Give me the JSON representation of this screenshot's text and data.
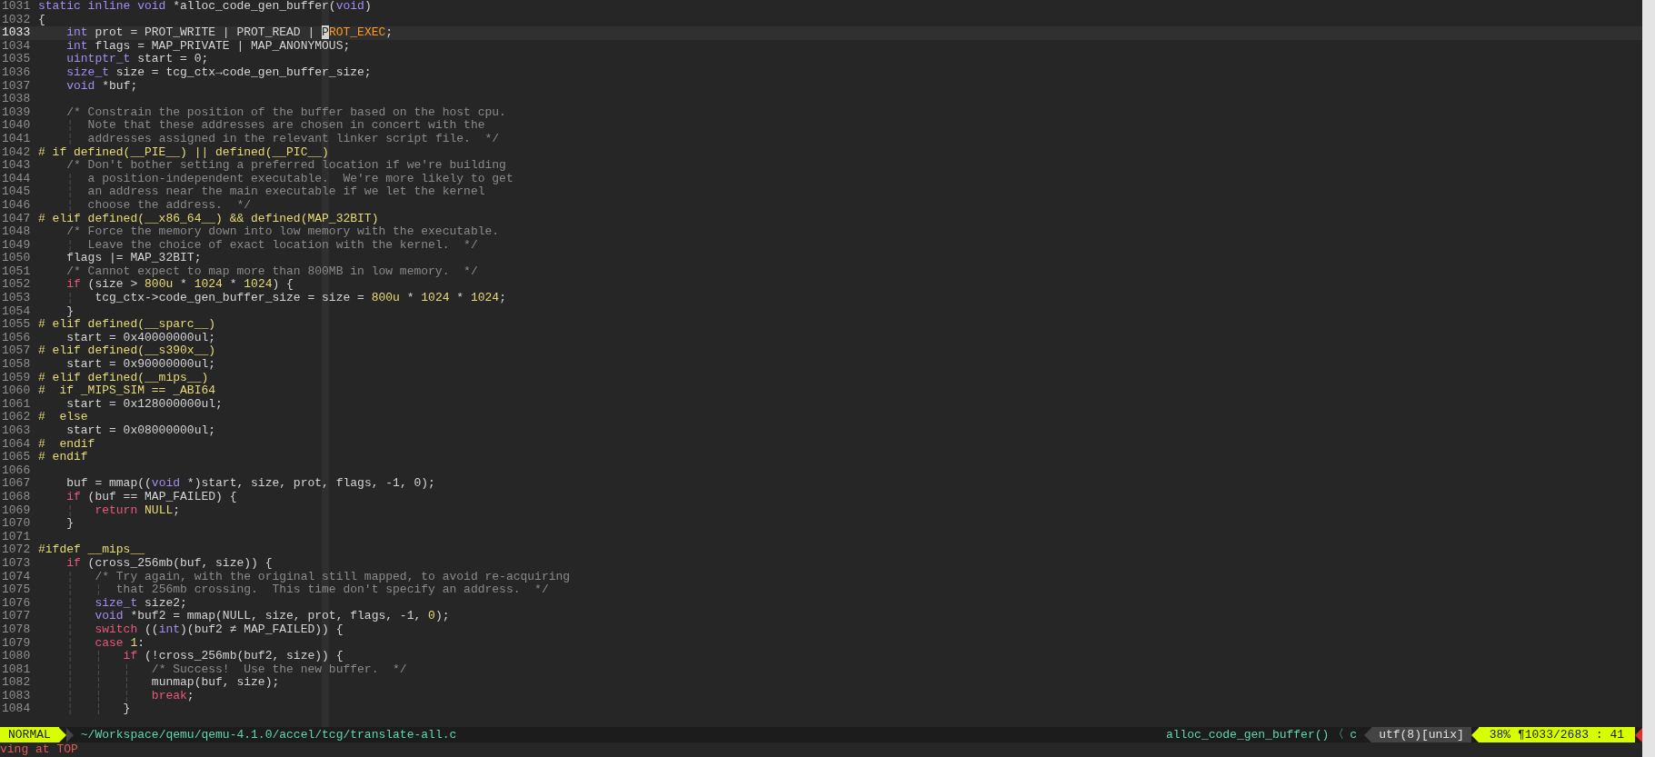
{
  "editor": {
    "lines": [
      {
        "number": "1031",
        "current": false,
        "segments": [
          {
            "kind": "type",
            "text": "static inline void"
          },
          {
            "kind": "plain",
            "text": " *alloc_code_gen_buffer("
          },
          {
            "kind": "type",
            "text": "void"
          },
          {
            "kind": "plain",
            "text": ")"
          }
        ]
      },
      {
        "number": "1032",
        "current": false,
        "segments": [
          {
            "kind": "plain",
            "text": "{"
          }
        ]
      },
      {
        "number": "1033",
        "current": true,
        "segments": [
          {
            "kind": "type",
            "text": "    int"
          },
          {
            "kind": "plain",
            "text": " prot = PROT_WRITE | PROT_READ | "
          },
          {
            "kind": "cursor",
            "text": "P"
          },
          {
            "kind": "match",
            "text": "ROT_EXEC"
          },
          {
            "kind": "plain",
            "text": ";"
          }
        ]
      },
      {
        "number": "1034",
        "current": false,
        "segments": [
          {
            "kind": "type",
            "text": "    int"
          },
          {
            "kind": "plain",
            "text": " flags = MAP_PRIVATE | MAP_ANONYMOUS;"
          }
        ]
      },
      {
        "number": "1035",
        "current": false,
        "segments": [
          {
            "kind": "type",
            "text": "    uintptr_t"
          },
          {
            "kind": "plain",
            "text": " start = 0;"
          }
        ]
      },
      {
        "number": "1036",
        "current": false,
        "segments": [
          {
            "kind": "type",
            "text": "    size_t"
          },
          {
            "kind": "plain",
            "text": " size = tcg_ctx→code_gen_buffer_size;"
          }
        ]
      },
      {
        "number": "1037",
        "current": false,
        "segments": [
          {
            "kind": "type",
            "text": "    void"
          },
          {
            "kind": "plain",
            "text": " *buf;"
          }
        ]
      },
      {
        "number": "1038",
        "current": false
      },
      {
        "number": "1039",
        "current": false,
        "segments": [
          {
            "kind": "comment",
            "text": "    /* Constrain the position of the buffer based on the host cpu."
          }
        ]
      },
      {
        "number": "1040",
        "current": false,
        "segments": [
          {
            "kind": "guide",
            "text": "    ¦"
          },
          {
            "kind": "comment",
            "text": "  Note that these addresses are chosen in concert with the"
          }
        ]
      },
      {
        "number": "1041",
        "current": false,
        "segments": [
          {
            "kind": "guide",
            "text": "    ¦"
          },
          {
            "kind": "comment",
            "text": "  addresses assigned in the relevant linker script file.  */"
          }
        ]
      },
      {
        "number": "1042",
        "current": false,
        "segments": [
          {
            "kind": "preproc",
            "text": "# if defined(__PIE__) || defined(__PIC__)"
          }
        ]
      },
      {
        "number": "1043",
        "current": false,
        "segments": [
          {
            "kind": "comment",
            "text": "    /* Don't bother setting a preferred location if we're building"
          }
        ]
      },
      {
        "number": "1044",
        "current": false,
        "segments": [
          {
            "kind": "guide",
            "text": "    ¦"
          },
          {
            "kind": "comment",
            "text": "  a position-independent executable.  We're more likely to get"
          }
        ]
      },
      {
        "number": "1045",
        "current": false,
        "segments": [
          {
            "kind": "guide",
            "text": "    ¦"
          },
          {
            "kind": "comment",
            "text": "  an address near the main executable if we let the kernel"
          }
        ]
      },
      {
        "number": "1046",
        "current": false,
        "segments": [
          {
            "kind": "guide",
            "text": "    ¦"
          },
          {
            "kind": "comment",
            "text": "  choose the address.  */"
          }
        ]
      },
      {
        "number": "1047",
        "current": false,
        "segments": [
          {
            "kind": "preproc",
            "text": "# elif defined(__x86_64__) && defined(MAP_32BIT)"
          }
        ]
      },
      {
        "number": "1048",
        "current": false,
        "segments": [
          {
            "kind": "comment",
            "text": "    /* Force the memory down into low memory with the executable."
          }
        ]
      },
      {
        "number": "1049",
        "current": false,
        "segments": [
          {
            "kind": "guide",
            "text": "    ¦"
          },
          {
            "kind": "comment",
            "text": "  Leave the choice of exact location with the kernel.  */"
          }
        ]
      },
      {
        "number": "1050",
        "current": false,
        "segments": [
          {
            "kind": "plain",
            "text": "    flags |= MAP_32BIT;"
          }
        ]
      },
      {
        "number": "1051",
        "current": false,
        "segments": [
          {
            "kind": "comment",
            "text": "    /* Cannot expect to map more than 800MB in low memory.  */"
          }
        ]
      },
      {
        "number": "1052",
        "current": false,
        "segments": [
          {
            "kind": "keyword",
            "text": "    if"
          },
          {
            "kind": "plain",
            "text": " (size > "
          },
          {
            "kind": "number",
            "text": "800u"
          },
          {
            "kind": "plain",
            "text": " * "
          },
          {
            "kind": "number",
            "text": "1024"
          },
          {
            "kind": "plain",
            "text": " * "
          },
          {
            "kind": "number",
            "text": "1024"
          },
          {
            "kind": "plain",
            "text": ") {"
          }
        ]
      },
      {
        "number": "1053",
        "current": false,
        "segments": [
          {
            "kind": "guide",
            "text": "    ¦"
          },
          {
            "kind": "plain",
            "text": "   tcg_ctx->code_gen_buffer_size = size = "
          },
          {
            "kind": "number",
            "text": "800u"
          },
          {
            "kind": "plain",
            "text": " * "
          },
          {
            "kind": "number",
            "text": "1024"
          },
          {
            "kind": "plain",
            "text": " * "
          },
          {
            "kind": "number",
            "text": "1024"
          },
          {
            "kind": "plain",
            "text": ";"
          }
        ]
      },
      {
        "number": "1054",
        "current": false,
        "segments": [
          {
            "kind": "plain",
            "text": "    }"
          }
        ]
      },
      {
        "number": "1055",
        "current": false,
        "segments": [
          {
            "kind": "preproc",
            "text": "# elif defined(__sparc__)"
          }
        ]
      },
      {
        "number": "1056",
        "current": false,
        "segments": [
          {
            "kind": "plain",
            "text": "    start = 0x40000000ul;"
          }
        ]
      },
      {
        "number": "1057",
        "current": false,
        "segments": [
          {
            "kind": "preproc",
            "text": "# elif defined(__s390x__)"
          }
        ]
      },
      {
        "number": "1058",
        "current": false,
        "segments": [
          {
            "kind": "plain",
            "text": "    start = 0x90000000ul;"
          }
        ]
      },
      {
        "number": "1059",
        "current": false,
        "segments": [
          {
            "kind": "preproc",
            "text": "# elif defined(__mips__)"
          }
        ]
      },
      {
        "number": "1060",
        "current": false,
        "segments": [
          {
            "kind": "preproc",
            "text": "#  if _MIPS_SIM == _ABI64"
          }
        ]
      },
      {
        "number": "1061",
        "current": false,
        "segments": [
          {
            "kind": "plain",
            "text": "    start = 0x128000000ul;"
          }
        ]
      },
      {
        "number": "1062",
        "current": false,
        "segments": [
          {
            "kind": "preproc",
            "text": "#  else"
          }
        ]
      },
      {
        "number": "1063",
        "current": false,
        "segments": [
          {
            "kind": "plain",
            "text": "    start = 0x08000000ul;"
          }
        ]
      },
      {
        "number": "1064",
        "current": false,
        "segments": [
          {
            "kind": "preproc",
            "text": "#  endif"
          }
        ]
      },
      {
        "number": "1065",
        "current": false,
        "segments": [
          {
            "kind": "preproc",
            "text": "# endif"
          }
        ]
      },
      {
        "number": "1066",
        "current": false
      },
      {
        "number": "1067",
        "current": false,
        "segments": [
          {
            "kind": "plain",
            "text": "    buf = mmap(("
          },
          {
            "kind": "type",
            "text": "void"
          },
          {
            "kind": "plain",
            "text": " *)start, size, prot, flags, -1, 0);"
          }
        ]
      },
      {
        "number": "1068",
        "current": false,
        "segments": [
          {
            "kind": "keyword",
            "text": "    if"
          },
          {
            "kind": "plain",
            "text": " (buf == MAP_FAILED) {"
          }
        ]
      },
      {
        "number": "1069",
        "current": false,
        "segments": [
          {
            "kind": "guide",
            "text": "    ¦"
          },
          {
            "kind": "keyword",
            "text": "   return"
          },
          {
            "kind": "number",
            "text": " NULL"
          },
          {
            "kind": "plain",
            "text": ";"
          }
        ]
      },
      {
        "number": "1070",
        "current": false,
        "segments": [
          {
            "kind": "plain",
            "text": "    }"
          }
        ]
      },
      {
        "number": "1071",
        "current": false
      },
      {
        "number": "1072",
        "current": false,
        "segments": [
          {
            "kind": "preproc",
            "text": "#ifdef __mips__"
          }
        ]
      },
      {
        "number": "1073",
        "current": false,
        "segments": [
          {
            "kind": "keyword",
            "text": "    if"
          },
          {
            "kind": "plain",
            "text": " (cross_256mb(buf, size)) {"
          }
        ]
      },
      {
        "number": "1074",
        "current": false,
        "segments": [
          {
            "kind": "guide",
            "text": "    ¦"
          },
          {
            "kind": "comment",
            "text": "   /* Try again, with the original still mapped, to avoid re-acquiring"
          }
        ]
      },
      {
        "number": "1075",
        "current": false,
        "segments": [
          {
            "kind": "guide",
            "text": "    ¦   ¦"
          },
          {
            "kind": "comment",
            "text": "  that 256mb crossing.  This time don't specify an address.  */"
          }
        ]
      },
      {
        "number": "1076",
        "current": false,
        "segments": [
          {
            "kind": "guide",
            "text": "    ¦"
          },
          {
            "kind": "type",
            "text": "   size_t"
          },
          {
            "kind": "plain",
            "text": " size2;"
          }
        ]
      },
      {
        "number": "1077",
        "current": false,
        "segments": [
          {
            "kind": "guide",
            "text": "    ¦"
          },
          {
            "kind": "type",
            "text": "   void"
          },
          {
            "kind": "plain",
            "text": " *buf2 = mmap(NULL, size, prot, flags, -1, "
          },
          {
            "kind": "number",
            "text": "0"
          },
          {
            "kind": "plain",
            "text": ");"
          }
        ]
      },
      {
        "number": "1078",
        "current": false,
        "segments": [
          {
            "kind": "guide",
            "text": "    ¦"
          },
          {
            "kind": "keyword",
            "text": "   switch"
          },
          {
            "kind": "plain",
            "text": " (("
          },
          {
            "kind": "type",
            "text": "int"
          },
          {
            "kind": "plain",
            "text": ")(buf2 ≠ MAP_FAILED)) {"
          }
        ]
      },
      {
        "number": "1079",
        "current": false,
        "segments": [
          {
            "kind": "guide",
            "text": "    ¦"
          },
          {
            "kind": "keyword",
            "text": "   case"
          },
          {
            "kind": "number",
            "text": " 1"
          },
          {
            "kind": "plain",
            "text": ":"
          }
        ]
      },
      {
        "number": "1080",
        "current": false,
        "segments": [
          {
            "kind": "guide",
            "text": "    ¦   ¦"
          },
          {
            "kind": "keyword",
            "text": "   if"
          },
          {
            "kind": "plain",
            "text": " (!cross_256mb(buf2, size)) {"
          }
        ]
      },
      {
        "number": "1081",
        "current": false,
        "segments": [
          {
            "kind": "guide",
            "text": "    ¦   ¦   ¦"
          },
          {
            "kind": "comment",
            "text": "   /* Success!  Use the new buffer.  */"
          }
        ]
      },
      {
        "number": "1082",
        "current": false,
        "segments": [
          {
            "kind": "guide",
            "text": "    ¦   ¦   ¦"
          },
          {
            "kind": "plain",
            "text": "   munmap(buf, size);"
          }
        ]
      },
      {
        "number": "1083",
        "current": false,
        "segments": [
          {
            "kind": "guide",
            "text": "    ¦   ¦   ¦"
          },
          {
            "kind": "keyword",
            "text": "   break"
          },
          {
            "kind": "plain",
            "text": ";"
          }
        ]
      },
      {
        "number": "1084",
        "current": false,
        "segments": [
          {
            "kind": "guide",
            "text": "    ¦   ¦"
          },
          {
            "kind": "plain",
            "text": "   }"
          }
        ]
      }
    ]
  },
  "status_line": {
    "mode": "NORMAL",
    "file_path": "~/Workspace/qemu/qemu-4.1.0/accel/tcg/translate-all.c",
    "function": "alloc_code_gen_buffer()",
    "separator": "〈",
    "filetype": "c",
    "encoding": "utf(8)[unix]",
    "position": "38% ¶1033/2683 : 41"
  },
  "command_line": {
    "message": "ving at TOP"
  }
}
